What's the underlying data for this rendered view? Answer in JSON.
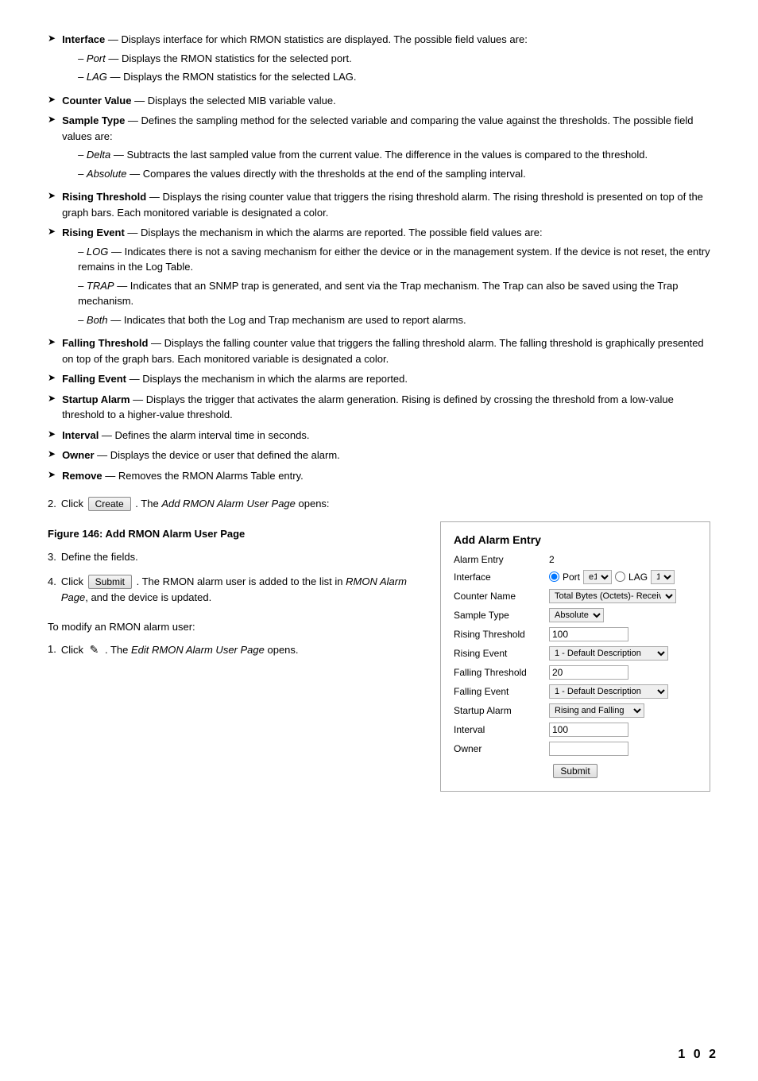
{
  "bullets": [
    {
      "label": "Interface",
      "text": " — Displays interface for which RMON statistics are displayed. The possible field values are:",
      "subs": [
        "– Port — Displays the RMON statistics for the selected port.",
        "– LAG — Displays the RMON statistics for the selected LAG."
      ]
    },
    {
      "label": "Counter Value",
      "text": " — Displays the selected MIB variable value.",
      "subs": []
    },
    {
      "label": "Sample Type",
      "text": " — Defines the sampling method for the selected variable and comparing the value against the thresholds. The possible field values are:",
      "subs": [
        "– Delta — Subtracts the last sampled value from the current value. The difference in the values is compared to the threshold.",
        "– Absolute — Compares the values directly with the thresholds at the end of the sampling interval."
      ]
    },
    {
      "label": "Rising Threshold",
      "text": " — Displays the rising counter value that triggers the rising threshold alarm. The rising threshold is presented on top of the graph bars. Each monitored variable is designated a color.",
      "subs": []
    },
    {
      "label": "Rising Event",
      "text": " — Displays the mechanism in which the alarms are reported. The possible field values are:",
      "subs": [
        "– LOG — Indicates there is not a saving mechanism for either the device or in the management system. If the device is not reset, the entry remains in the Log Table.",
        "– TRAP — Indicates that an SNMP trap is generated, and sent via the Trap mechanism. The Trap can also be saved using the Trap mechanism.",
        "– Both — Indicates that both the Log and Trap mechanism are used to report alarms."
      ]
    },
    {
      "label": "Falling Threshold",
      "text": " — Displays the falling counter value that triggers the falling threshold alarm. The falling threshold is graphically presented on top of the graph bars. Each monitored variable is designated a color.",
      "subs": []
    },
    {
      "label": "Falling Event",
      "text": " — Displays the mechanism in which the alarms are reported.",
      "subs": []
    },
    {
      "label": "Startup Alarm",
      "text": " — Displays the trigger that activates the alarm generation. Rising is defined by crossing the threshold from a low-value threshold to a higher-value threshold.",
      "subs": []
    },
    {
      "label": "Interval",
      "text": " — Defines the alarm interval time in seconds.",
      "subs": []
    },
    {
      "label": "Owner",
      "text": " — Displays the device or user that defined the alarm.",
      "subs": []
    },
    {
      "label": "Remove",
      "text": " — Removes the RMON Alarms Table entry.",
      "subs": []
    }
  ],
  "step2": {
    "num": "2.",
    "pre": "Click",
    "btn": "Create",
    "post": ". The",
    "italic": "Add RMON Alarm User Page",
    "suffix": "opens:"
  },
  "figure_caption": "Figure 146: Add RMON Alarm User Page",
  "step3": {
    "num": "3.",
    "text": "Define the fields."
  },
  "step4": {
    "num": "4.",
    "pre": "Click",
    "btn": "Submit",
    "post": ". The RMON alarm user is added to the list in",
    "italic": "RMON Alarm Page",
    "suffix": ", and the device is updated."
  },
  "modify_heading": "To modify an RMON alarm user:",
  "modify_step1": {
    "num": "1.",
    "pre": "Click",
    "icon": "✎",
    "post": ". The",
    "italic": "Edit RMON Alarm User Page",
    "suffix": "opens."
  },
  "form": {
    "title": "Add Alarm Entry",
    "fields": [
      {
        "label": "Alarm Entry",
        "type": "text_static",
        "value": "2"
      },
      {
        "label": "Interface",
        "type": "radio_select",
        "value": ""
      },
      {
        "label": "Counter Name",
        "type": "select",
        "value": "Total Bytes (Octets)- Receive"
      },
      {
        "label": "Sample Type",
        "type": "select",
        "value": "Absolute"
      },
      {
        "label": "Rising Threshold",
        "type": "text",
        "value": "100"
      },
      {
        "label": "Rising Event",
        "type": "select",
        "value": "1 - Default Description"
      },
      {
        "label": "Falling Threshold",
        "type": "text",
        "value": "20"
      },
      {
        "label": "Falling Event",
        "type": "select",
        "value": "1 - Default Description"
      },
      {
        "label": "Startup Alarm",
        "type": "select",
        "value": "Rising and Falling"
      },
      {
        "label": "Interval",
        "type": "text",
        "value": "100"
      },
      {
        "label": "Owner",
        "type": "text",
        "value": ""
      }
    ],
    "submit_btn": "Submit"
  },
  "page_number": "1 0 2"
}
